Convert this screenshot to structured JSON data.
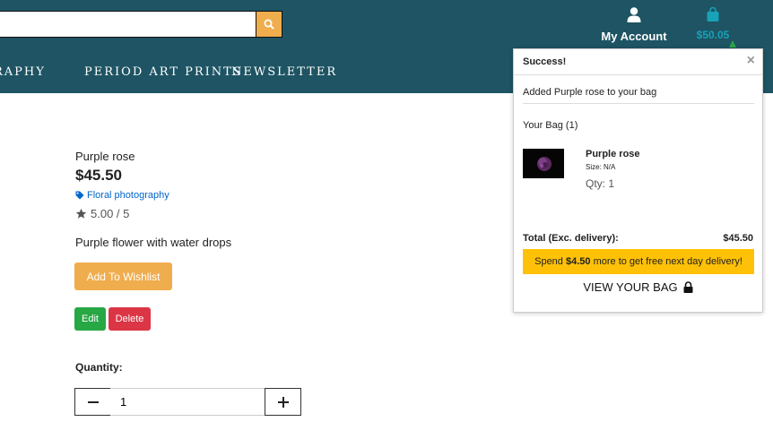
{
  "header": {
    "search": {
      "value": "",
      "placeholder": ""
    },
    "account": {
      "label": "My Account"
    },
    "bag": {
      "amount": "$50.05"
    },
    "nav": [
      {
        "label": "RAPHY"
      },
      {
        "label": "PERIOD ART PRINTS"
      },
      {
        "label": "NEWSLETTER"
      }
    ]
  },
  "product": {
    "name": "Purple rose",
    "price": "$45.50",
    "category": "Floral photography",
    "rating": "5.00 / 5",
    "description": "Purple flower with water drops",
    "wishlist_label": "Add To Wishlist",
    "edit_label": "Edit",
    "delete_label": "Delete",
    "quantity_label": "Quantity:",
    "quantity_value": "1"
  },
  "toast": {
    "title": "Success!",
    "message": "Added Purple rose to your bag",
    "bag_count": "Your Bag (1)",
    "item": {
      "name": "Purple rose",
      "size": "Size: N/A",
      "qty": "Qty: 1"
    },
    "total_label": "Total (Exc. delivery):",
    "total_value": "$45.50",
    "free_delivery": {
      "prefix": "Spend ",
      "amount": "$4.50",
      "suffix": " more to get free next day delivery!"
    },
    "view_bag_label": "VIEW YOUR BAG"
  },
  "colors": {
    "header_bg": "#1e5463",
    "accent": "#f0ad4e",
    "bag": "#17a2b8",
    "success": "#28a745",
    "danger": "#dc3545",
    "banner": "#ffc107",
    "link": "#0066cc"
  }
}
